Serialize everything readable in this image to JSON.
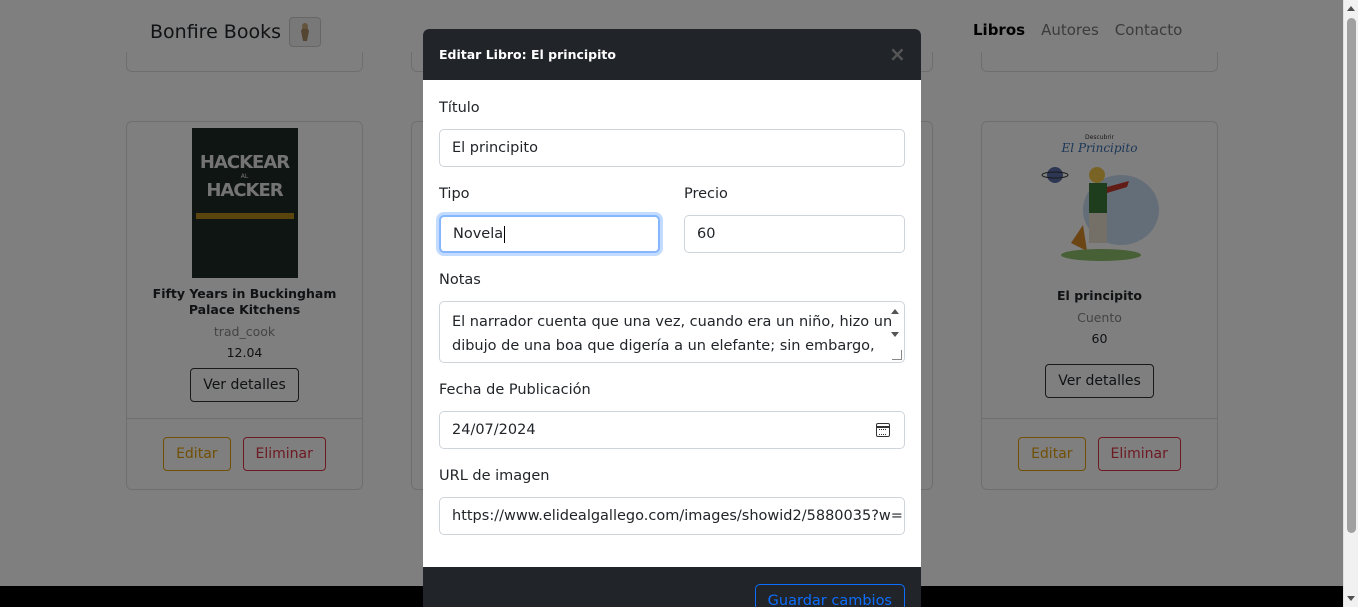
{
  "navbar": {
    "brand": "Bonfire Books",
    "links": [
      "Libros",
      "Autores",
      "Contacto"
    ]
  },
  "cards": [
    {
      "cover_text_top": "HACKEAR",
      "cover_text_mid": "AL",
      "cover_text_bottom": "HACKER",
      "title": "Fifty Years in Buckingham Palace Kitchens",
      "type": "trad_cook",
      "price": "12.04",
      "details_label": "Ver detalles",
      "edit_label": "Editar",
      "delete_label": "Eliminar"
    },
    {
      "cover_text_top": "Descubrir",
      "cover_text_mid": "El Principito",
      "title": "El principito",
      "type": "Cuento",
      "price": "60",
      "details_label": "Ver detalles",
      "edit_label": "Editar",
      "delete_label": "Eliminar"
    }
  ],
  "modal": {
    "title": "Editar Libro: El principito",
    "close_icon": "×",
    "fields": {
      "titulo_label": "Título",
      "titulo_value": "El principito",
      "tipo_label": "Tipo",
      "tipo_value": "Novela",
      "precio_label": "Precio",
      "precio_value": "60",
      "notas_label": "Notas",
      "notas_line1": "El narrador cuenta que una vez, cuando era un niño, hizo un",
      "notas_line2": "dibujo de una boa que digería a un elefante; sin embargo,",
      "fecha_label": "Fecha de Publicación",
      "fecha_value": "24/07/2024",
      "url_label": "URL de imagen",
      "url_value": "https://www.elidealgallego.com/images/showid2/5880035?w="
    },
    "save_label": "Guardar cambios"
  },
  "colors": {
    "header_bg": "#212529",
    "primary": "#0d6efd",
    "warning": "#e3a008",
    "danger": "#dc3545"
  }
}
